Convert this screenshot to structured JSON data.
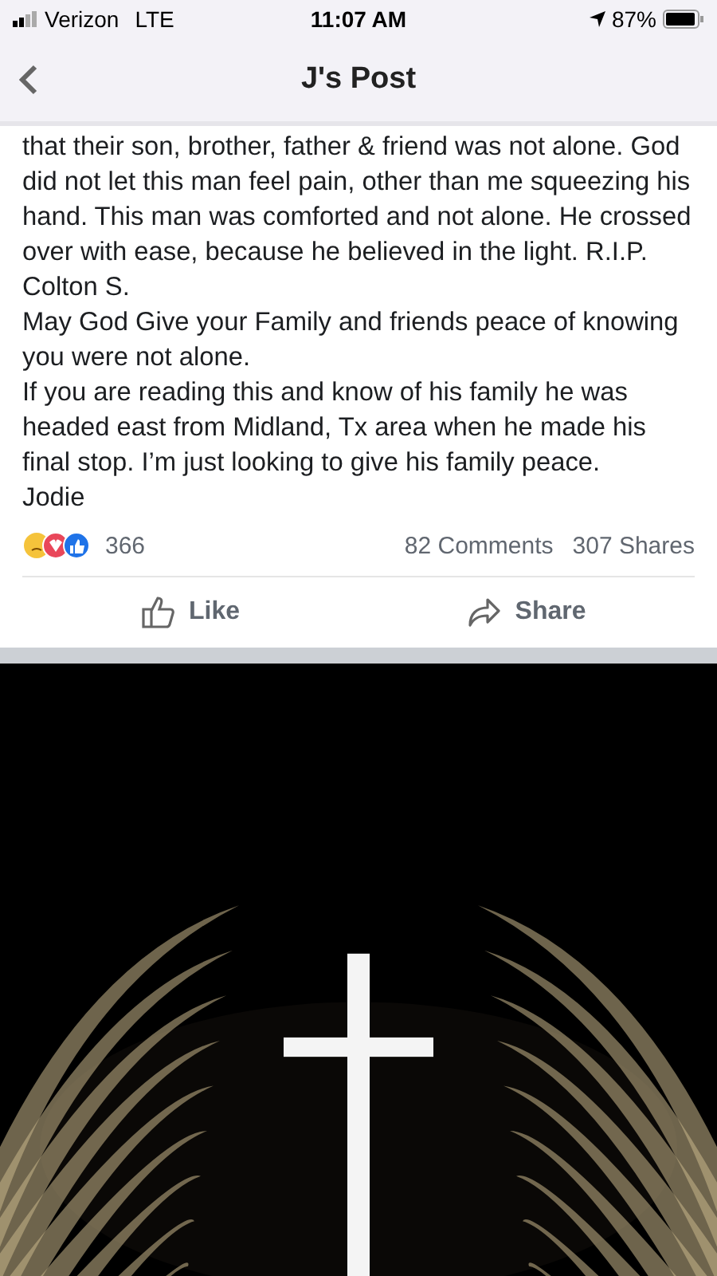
{
  "status_bar": {
    "carrier": "Verizon",
    "network": "LTE",
    "time": "11:07 AM",
    "battery": "87%"
  },
  "nav": {
    "title": "J's Post"
  },
  "post": {
    "paragraphs": [
      "that their son, brother, father & friend was not alone. God did not let this man feel pain, other than me squeezing his hand. This man was comforted and not alone. He crossed over with ease, because he believed in the light.  R.I.P. Colton S.",
      "May God Give your Family and friends peace of knowing you were not alone.",
      "If you are reading this and know of his family he was headed east from Midland, Tx area when he made his final stop. I’m just looking to give his family peace.",
      "Jodie"
    ],
    "reactions": "366",
    "comments": "82 Comments",
    "shares": "307 Shares",
    "actions": [
      {
        "kind": "like",
        "label": "Like"
      },
      {
        "kind": "share",
        "label": "Share"
      }
    ]
  }
}
